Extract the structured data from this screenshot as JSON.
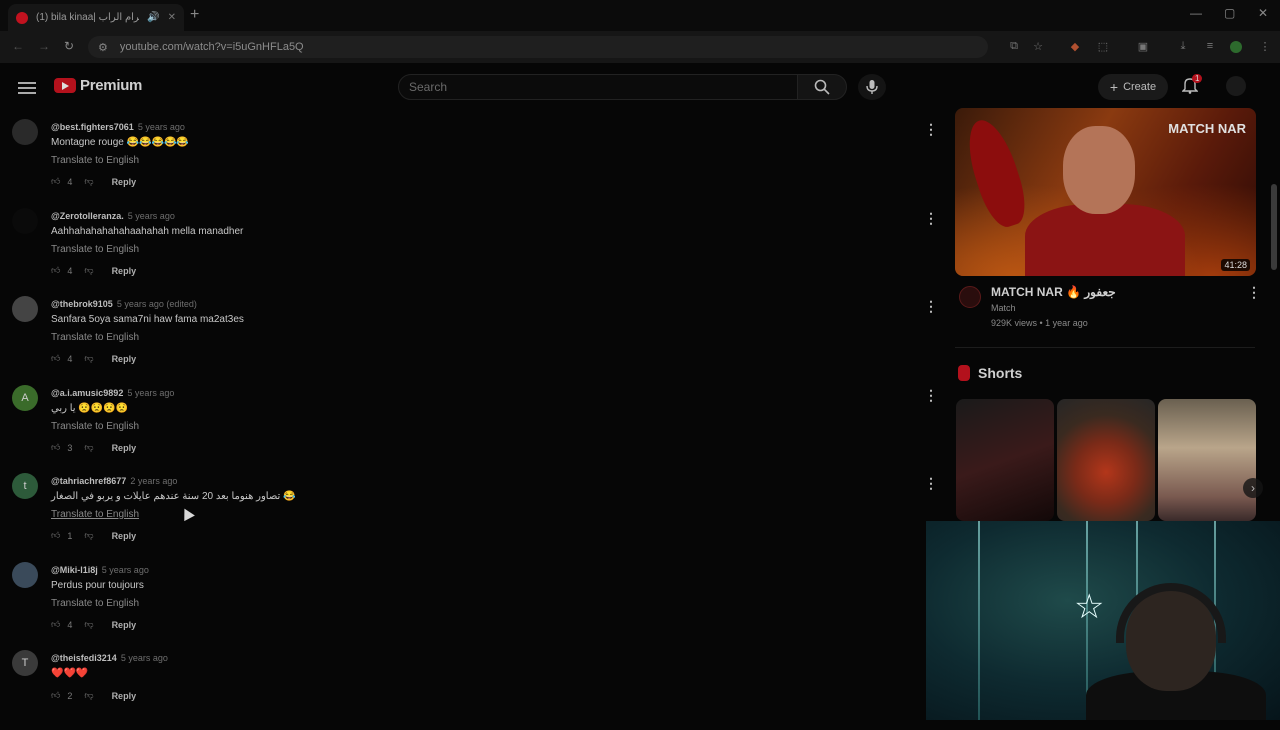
{
  "browser": {
    "tab_title": "(1) bila kinaa| حمو عرام الراب",
    "url": "youtube.com/watch?v=i5uGnHFLa5Q",
    "notification_count": "1"
  },
  "header": {
    "logo_text": "Premium",
    "search_placeholder": "Search",
    "create_label": "Create",
    "notification_badge": "1"
  },
  "comments": [
    {
      "handle": "@best.fighters7061",
      "time": "5 years ago",
      "text": "Montagne rouge 😂😂😂😂😂",
      "translate": "Translate to English",
      "likes": "4",
      "reply": "Reply",
      "avatar_letter": "",
      "avatar_color": "#2a2a2a"
    },
    {
      "handle": "@Zerotolleranza.",
      "time": "5 years ago",
      "text": "Aahhahahahahahaahahah mella manadher",
      "translate": "Translate to English",
      "likes": "4",
      "reply": "Reply",
      "avatar_letter": "",
      "avatar_color": "#0a0a0a"
    },
    {
      "handle": "@thebrok9105",
      "time": "5 years ago (edited)",
      "text": "Sanfara 5oya sama7ni haw fama ma2at3es",
      "translate": "Translate to English",
      "likes": "4",
      "reply": "Reply",
      "avatar_letter": "",
      "avatar_color": "#444444"
    },
    {
      "handle": "@a.i.amusic9892",
      "time": "5 years ago",
      "text": "يا ربي 😟😟😟😟",
      "translate": "Translate to English",
      "likes": "3",
      "reply": "Reply",
      "avatar_letter": "A",
      "avatar_color": "#3a6b2a"
    },
    {
      "handle": "@tahriachref8677",
      "time": "2 years ago",
      "text": "تصاور هنوما بعد 20 سنة عندهم عايلات و يربو في الصغار 😂",
      "translate": "Translate to English",
      "likes": "1",
      "reply": "Reply",
      "avatar_letter": "t",
      "avatar_color": "#2d5a3a"
    },
    {
      "handle": "@Miki-l1i8j",
      "time": "5 years ago",
      "text": "Perdus pour toujours",
      "translate": "Translate to English",
      "likes": "4",
      "reply": "Reply",
      "avatar_letter": "",
      "avatar_color": "#3a4a5a"
    },
    {
      "handle": "@theisfedi3214",
      "time": "5 years ago",
      "text": "❤️❤️❤️",
      "translate": "",
      "likes": "2",
      "reply": "Reply",
      "avatar_letter": "T",
      "avatar_color": "#3a3a3a"
    }
  ],
  "recommended": {
    "title": "MATCH NAR 🔥 جعفور",
    "channel": "Match",
    "stats": "929K views • 1 year ago",
    "duration": "41:28",
    "thumb_brand": "MATCH NAR"
  },
  "shorts": {
    "label": "Shorts"
  }
}
